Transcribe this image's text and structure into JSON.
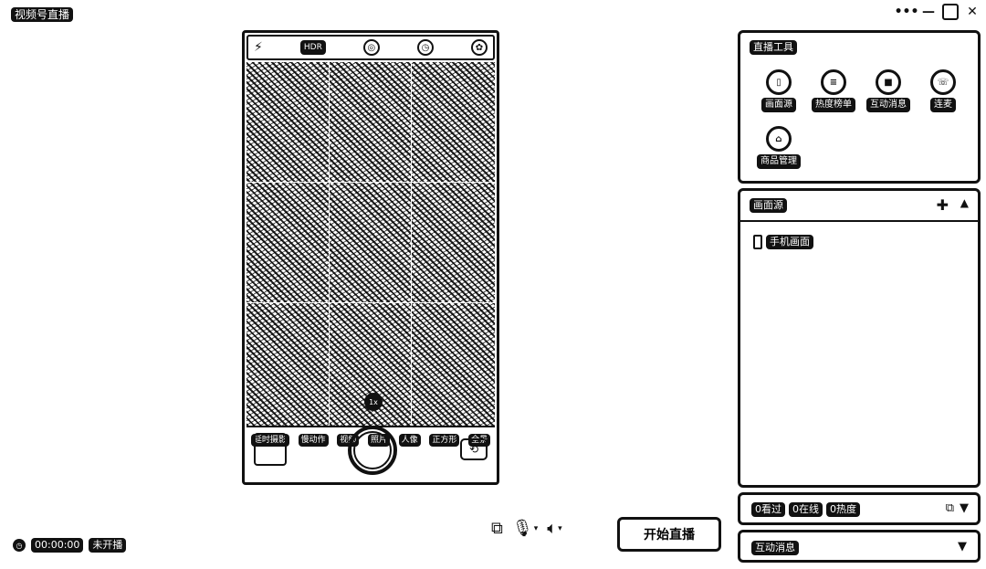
{
  "window": {
    "title": "视频号直播",
    "controls": {
      "more": "•••",
      "minimize": "—",
      "maximize": "□",
      "close": "✕"
    }
  },
  "camera": {
    "topbar": {
      "flash_icon": "⚡",
      "hdr": "HDR",
      "live_icon": "◎",
      "timer_icon": "◷",
      "filter_icon": "✿"
    },
    "zoom": "1x",
    "modes": [
      "延时摄影",
      "慢动作",
      "视频",
      "照片",
      "人像",
      "正方形",
      "全景"
    ],
    "flip_icon": "⟲"
  },
  "status": {
    "time": "00:00:00",
    "state": "未开播"
  },
  "controls": {
    "start_live": "开始直播"
  },
  "tools": {
    "title": "直播工具",
    "items": [
      {
        "label": "画面源",
        "icon": "▯"
      },
      {
        "label": "热度榜单",
        "icon": "≡"
      },
      {
        "label": "互动消息",
        "icon": "■"
      },
      {
        "label": "连麦",
        "icon": "☏"
      },
      {
        "label": "商品管理",
        "icon": "⌂"
      }
    ]
  },
  "source": {
    "title": "画面源",
    "items": [
      {
        "label": "手机画面"
      }
    ]
  },
  "stats": {
    "watched": "0看过",
    "online": "0在线",
    "heat": "0热度"
  },
  "messages": {
    "title": "互动消息"
  }
}
